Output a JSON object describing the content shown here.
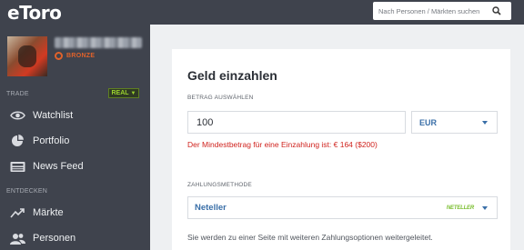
{
  "app": {
    "logo_text": "eToro"
  },
  "profile": {
    "username": "",
    "rank": "BRONZE"
  },
  "sidebar": {
    "trade_header": "TRADE",
    "account_mode": "REAL",
    "trade_items": [
      {
        "label": "Watchlist",
        "icon": "eye-icon"
      },
      {
        "label": "Portfolio",
        "icon": "pie-chart-icon"
      },
      {
        "label": "News Feed",
        "icon": "newspaper-icon"
      }
    ],
    "discover_header": "ENTDECKEN",
    "discover_items": [
      {
        "label": "Märkte",
        "icon": "trend-up-icon"
      },
      {
        "label": "Personen",
        "icon": "people-icon"
      }
    ]
  },
  "search": {
    "placeholder": "Nach Personen / Märkten suchen"
  },
  "deposit": {
    "title": "Geld einzahlen",
    "amount_label": "BETRAG AUSWÄHLEN",
    "amount_value": "100",
    "currency": "EUR",
    "error": "Der Mindestbetrag für eine Einzahlung ist: € 164 ($200)",
    "method_label": "ZAHLUNGSMETHODE",
    "method_value": "Neteller",
    "method_logo": "NETELLER",
    "redirect_note": "Sie werden zu einer Seite mit weiteren Zahlungsoptionen weitergeleitet."
  },
  "colors": {
    "sidebar_bg": "#3f434d",
    "accent_blue": "#3a6fa8",
    "error_red": "#d0231e",
    "real_green": "#9bd22e",
    "bronze": "#e0622b"
  }
}
